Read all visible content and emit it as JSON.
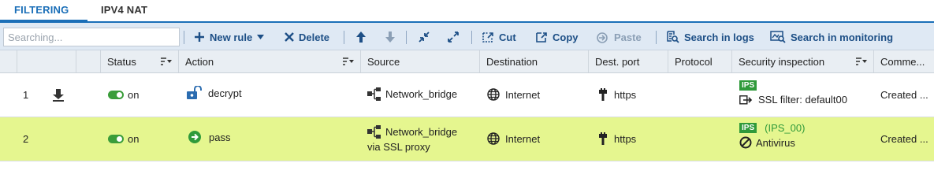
{
  "tabs": {
    "filtering": "FILTERING",
    "ipv4_nat": "IPV4 NAT"
  },
  "toolbar": {
    "search_placeholder": "Searching...",
    "new_rule": "New rule",
    "delete": "Delete",
    "cut": "Cut",
    "copy": "Copy",
    "paste": "Paste",
    "search_in_logs": "Search in logs",
    "search_in_monitoring": "Search in monitoring"
  },
  "columns": {
    "status": "Status",
    "action": "Action",
    "source": "Source",
    "destination": "Destination",
    "dest_port": "Dest. port",
    "protocol": "Protocol",
    "security_inspection": "Security inspection",
    "comment": "Comme..."
  },
  "rows": [
    {
      "number": "1",
      "status": "on",
      "action": "decrypt",
      "source_line1": "Network_bridge",
      "source_line2": "",
      "destination": "Internet",
      "dest_port": "https",
      "protocol": "",
      "ips_badge": "IPS",
      "inspection_extra": "",
      "inspection_line2": "SSL filter: default00",
      "comment": "Created ..."
    },
    {
      "number": "2",
      "status": "on",
      "action": "pass",
      "source_line1": "Network_bridge",
      "source_line2": "via SSL proxy",
      "destination": "Internet",
      "dest_port": "https",
      "protocol": "",
      "ips_badge": "IPS",
      "inspection_extra": "(IPS_00)",
      "inspection_line2": "Antivirus",
      "comment": "Created ..."
    }
  ],
  "colors": {
    "accent": "#1b6fb8",
    "toolbar_bg": "#dfe9f4",
    "toolbar_text": "#1d4f86",
    "selected_row": "#e5f68f",
    "toggle_on": "#3a9d3a",
    "ips_badge": "#2f9a3a"
  },
  "icons": {
    "first_rule": "arrow-down-bar-icon",
    "decrypt": "unlock-icon",
    "pass": "pass-arrow-icon",
    "source": "network-bridge-icon",
    "destination": "globe-icon",
    "port": "port-plug-icon",
    "ssl_filter": "ssl-filter-icon",
    "antivirus": "antivirus-icon"
  }
}
